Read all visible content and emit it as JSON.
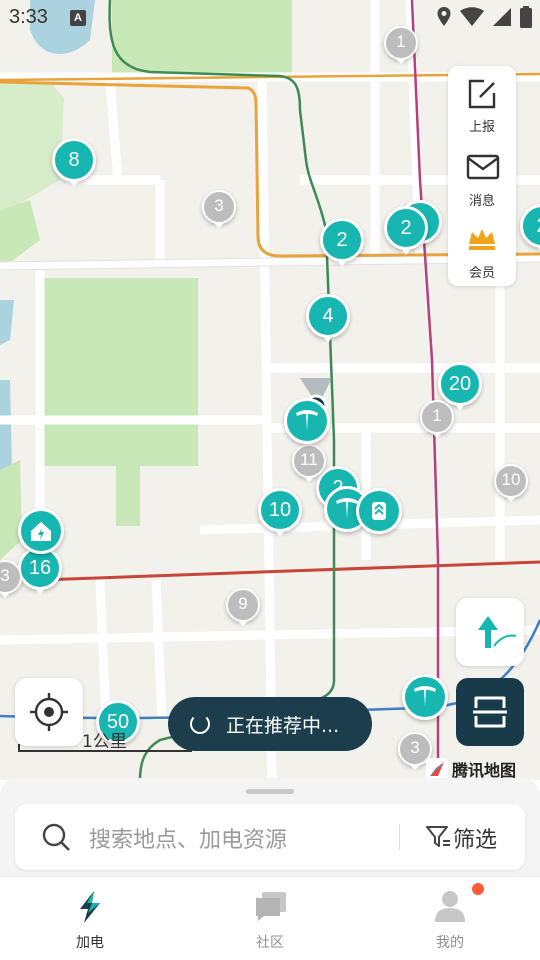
{
  "status_bar": {
    "time": "3:33",
    "a_icon": "A"
  },
  "map": {
    "clusters": [
      {
        "label": "8",
        "kind": "teal"
      },
      {
        "label": "2",
        "kind": "teal"
      },
      {
        "label": "2",
        "kind": "teal"
      },
      {
        "label": "2",
        "kind": "teal"
      },
      {
        "label": "2",
        "kind": "teal"
      },
      {
        "label": "4",
        "kind": "teal"
      },
      {
        "label": "20",
        "kind": "teal"
      },
      {
        "label": "10",
        "kind": "teal"
      },
      {
        "label": "2",
        "kind": "teal"
      },
      {
        "label": "16",
        "kind": "teal"
      },
      {
        "label": "50",
        "kind": "teal"
      },
      {
        "label": "1",
        "kind": "grey"
      },
      {
        "label": "3",
        "kind": "grey"
      },
      {
        "label": "1",
        "kind": "grey"
      },
      {
        "label": "11",
        "kind": "grey"
      },
      {
        "label": "10",
        "kind": "grey"
      },
      {
        "label": "9",
        "kind": "grey"
      },
      {
        "label": "3",
        "kind": "grey"
      },
      {
        "label": "3",
        "kind": "grey"
      }
    ],
    "scale_label": "1公里",
    "brand": "腾讯地图",
    "recommend_toast": "正在推荐中...",
    "colors": {
      "teal": "#17b6b1",
      "dark": "#173b4a",
      "road_orange": "#e8a33c",
      "road_red": "#c8453b",
      "metro_purple": "#b1427e",
      "metro_green": "#3d8a55",
      "park": "#c9e8b8",
      "water": "#aad3df"
    }
  },
  "tools": {
    "report_label": "上报",
    "message_label": "消息",
    "member_label": "会员"
  },
  "search": {
    "placeholder": "搜索地点、加电资源",
    "filter_label": "筛选"
  },
  "nav": {
    "items": [
      {
        "label": "加电",
        "icon": "charge-icon"
      },
      {
        "label": "社区",
        "icon": "community-icon"
      },
      {
        "label": "我的",
        "icon": "profile-icon"
      }
    ]
  }
}
